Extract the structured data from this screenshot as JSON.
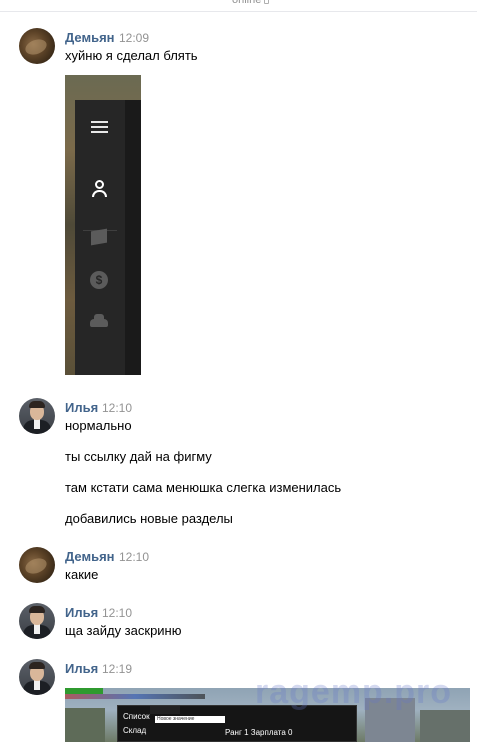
{
  "header": {
    "status": "online"
  },
  "messages": [
    {
      "author": "Демьян",
      "time": "12:09",
      "lines": [
        "хуйню я сделал блять"
      ],
      "avatar": "avatar-demyan"
    },
    {
      "author": "Илья",
      "time": "12:10",
      "lines": [
        "нормально",
        "ты ссылку дай на фигму",
        "там кстати сама менюшка слегка изменилась",
        "добавились новые разделы"
      ],
      "avatar": "avatar-ilya"
    },
    {
      "author": "Демьян",
      "time": "12:10",
      "lines": [
        "какие"
      ],
      "avatar": "avatar-demyan"
    },
    {
      "author": "Илья",
      "time": "12:10",
      "lines": [
        "ща зайду заскриню"
      ],
      "avatar": "avatar-ilya"
    },
    {
      "author": "Илья",
      "time": "12:19",
      "lines": [],
      "avatar": "avatar-ilya"
    }
  ],
  "attachment_menu": {
    "icons": [
      "menu-icon",
      "user-icon",
      "box-icon",
      "dollar-icon",
      "car-icon"
    ]
  },
  "attachment_game": {
    "tabs": [
      "Список",
      "Склад"
    ],
    "rank_text": "Ранг 1 Зарплата 0",
    "input_text": "Новое значение"
  },
  "watermark": "ragemp.pro"
}
